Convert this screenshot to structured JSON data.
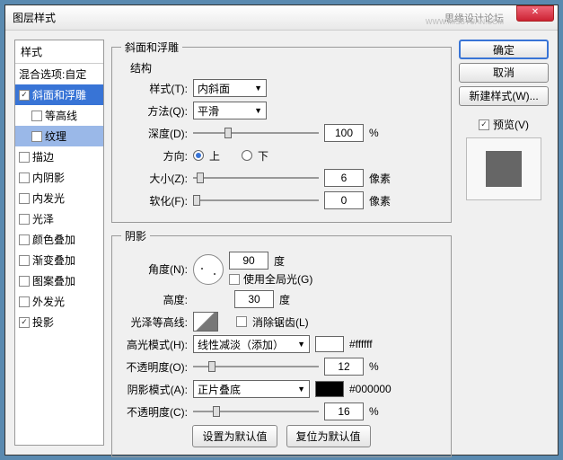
{
  "window": {
    "title": "图层样式",
    "watermark": "思缘设计论坛",
    "watermark2": "WWW.MISSYUAN.COM"
  },
  "left": {
    "header": "样式",
    "blend": "混合选项:自定",
    "items": [
      {
        "label": "斜面和浮雕",
        "checked": true,
        "selected": true
      },
      {
        "label": "等高线",
        "checked": false,
        "sub": true
      },
      {
        "label": "纹理",
        "checked": false,
        "sub": true,
        "subsel": true
      },
      {
        "label": "描边",
        "checked": false
      },
      {
        "label": "内阴影",
        "checked": false
      },
      {
        "label": "内发光",
        "checked": false
      },
      {
        "label": "光泽",
        "checked": false
      },
      {
        "label": "颜色叠加",
        "checked": false
      },
      {
        "label": "渐变叠加",
        "checked": false
      },
      {
        "label": "图案叠加",
        "checked": false
      },
      {
        "label": "外发光",
        "checked": false
      },
      {
        "label": "投影",
        "checked": true
      }
    ]
  },
  "bevel": {
    "group": "斜面和浮雕",
    "structure": "结构",
    "style_l": "样式(T):",
    "style_v": "内斜面",
    "method_l": "方法(Q):",
    "method_v": "平滑",
    "depth_l": "深度(D):",
    "depth_v": "100",
    "pct": "%",
    "dir_l": "方向:",
    "up": "上",
    "down": "下",
    "size_l": "大小(Z):",
    "size_v": "6",
    "px": "像素",
    "soft_l": "软化(F):",
    "soft_v": "0"
  },
  "shadow": {
    "group": "阴影",
    "angle_l": "角度(N):",
    "angle_v": "90",
    "deg": "度",
    "global": "使用全局光(G)",
    "alt_l": "高度:",
    "alt_v": "30",
    "gloss_l": "光泽等高线:",
    "aa": "消除锯齿(L)",
    "hmode_l": "高光模式(H):",
    "hmode_v": "线性减淡（添加）",
    "hcolor": "#ffffff",
    "hhex": "#ffffff",
    "hopac_l": "不透明度(O):",
    "hopac_v": "12",
    "smode_l": "阴影模式(A):",
    "smode_v": "正片叠底",
    "scolor": "#000000",
    "shex": "#000000",
    "sopac_l": "不透明度(C):",
    "sopac_v": "16"
  },
  "buttons": {
    "ok": "确定",
    "cancel": "取消",
    "newstyle": "新建样式(W)...",
    "preview": "预览(V)",
    "def1": "设置为默认值",
    "def2": "复位为默认值"
  }
}
